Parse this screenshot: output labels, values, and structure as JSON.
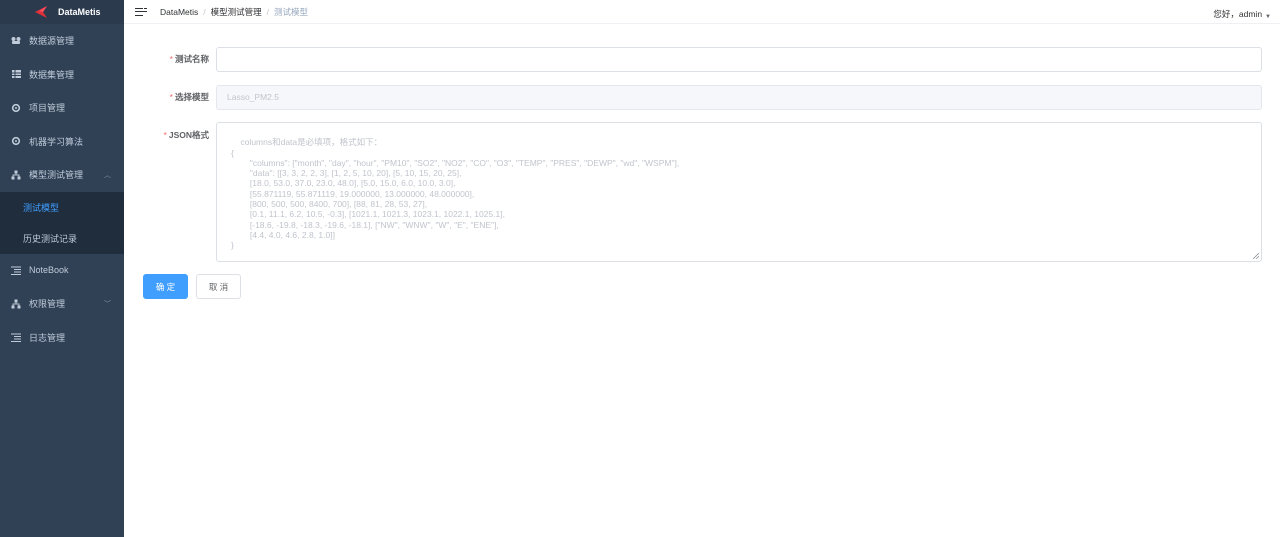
{
  "app": {
    "brand": "DataMetis"
  },
  "sidebar": {
    "items": [
      {
        "label": "数据源管理",
        "icon": "dashboard-icon"
      },
      {
        "label": "数据集管理",
        "icon": "table-icon"
      },
      {
        "label": "项目管理",
        "icon": "gear-icon"
      },
      {
        "label": "机器学习算法",
        "icon": "gear-icon"
      },
      {
        "label": "模型测试管理",
        "icon": "tree-icon",
        "expanded": true,
        "children": [
          {
            "label": "测试模型",
            "active": true
          },
          {
            "label": "历史测试记录"
          }
        ]
      },
      {
        "label": "NoteBook",
        "icon": "list-icon"
      },
      {
        "label": "权限管理",
        "icon": "tree-icon",
        "expanded": false
      },
      {
        "label": "日志管理",
        "icon": "list-icon"
      }
    ]
  },
  "header": {
    "breadcrumb": [
      "DataMetis",
      "模型测试管理",
      "测试模型"
    ],
    "separator": "/",
    "user_greeting": "您好，admin"
  },
  "form": {
    "test_name": {
      "label": "测试名称",
      "value": ""
    },
    "model": {
      "label": "选择模型",
      "value": "Lasso_PM2.5"
    },
    "json": {
      "label": "JSON格式",
      "placeholder": "columns和data是必填项，格式如下：\n{\n        \"columns\": [\"month\", \"day\", \"hour\", \"PM10\", \"SO2\", \"NO2\", \"CO\", \"O3\", \"TEMP\", \"PRES\", \"DEWP\", \"wd\", \"WSPM\"],\n        \"data\": [[3, 3, 2, 2, 3], [1, 2, 5, 10, 20], [5, 10, 15, 20, 25],\n        [18.0, 53.0, 37.0, 23.0, 48.0], [5.0, 15.0, 6.0, 10.0, 3.0],\n        [55.871119, 55.871119, 19.000000, 13.000000, 48.000000],\n        [800, 500, 500, 8400, 700], [88, 81, 28, 53, 27],\n        [0.1, 11.1, 6.2, 10.5, -0.3], [1021.1, 1021.3, 1023.1, 1022.1, 1025.1],\n        [-18.6, -19.8, -18.3, -19.6, -18.1], [\"NW\", \"WNW\", \"W\", \"E\", \"ENE\"],\n        [4.4, 4.0, 4.6, 2.8, 1.0]]\n}"
    },
    "required_mark": "*",
    "confirm_label": "确 定",
    "cancel_label": "取 消"
  },
  "colors": {
    "sidebar_bg": "#304156",
    "active": "#409eff",
    "primary": "#409eff",
    "required": "#f56c6c"
  }
}
